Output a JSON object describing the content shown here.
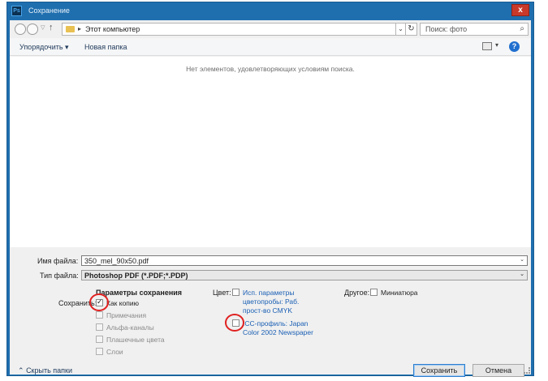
{
  "window": {
    "title": "Сохранение",
    "app_icon": "Ps",
    "close_glyph": "x"
  },
  "address_bar": {
    "path_separator": "▸",
    "location": "Этот компьютер",
    "search_placeholder": "Поиск: фото"
  },
  "toolbar": {
    "organize_label": "Упорядочить ▾",
    "new_folder_label": "Новая папка"
  },
  "file_list": {
    "empty_message": "Нет элементов, удовлетворяющих условиям поиска."
  },
  "form": {
    "filename_label": "Имя файла:",
    "filename_value": "350_mel_90x50.pdf",
    "filetype_label": "Тип файла:",
    "filetype_value": "Photoshop PDF (*.PDF;*.PDP)"
  },
  "save_options": {
    "title": "Параметры сохранения",
    "save_label": "Сохранить:",
    "options": [
      {
        "label": "Как копию",
        "checked": true,
        "enabled": true
      },
      {
        "label": "Примечания",
        "checked": false,
        "enabled": false
      },
      {
        "label": "Альфа-каналы",
        "checked": false,
        "enabled": false
      },
      {
        "label": "Плашечные цвета",
        "checked": false,
        "enabled": false
      },
      {
        "label": "Слои",
        "checked": false,
        "enabled": false
      }
    ]
  },
  "color_options": {
    "label": "Цвет:",
    "proof": {
      "line1": "Исп. параметры",
      "line2": "цветопробы:  Раб.",
      "line3": "прост-во CMYK",
      "checked": false
    },
    "icc": {
      "line1": "ICC-профиль:  Japan",
      "line2": "Color 2002 Newspaper",
      "checked": false
    }
  },
  "other_options": {
    "label": "Другое:",
    "thumbnail": {
      "label": "Миниатюра",
      "checked": false
    }
  },
  "footer": {
    "hide_folders": "Скрыть папки",
    "save_button": "Сохранить",
    "cancel_button": "Отмена"
  },
  "colors": {
    "title_bar": "#1f6faf",
    "annotation_ring": "#e02020",
    "link_blue": "#1a5fb4"
  }
}
